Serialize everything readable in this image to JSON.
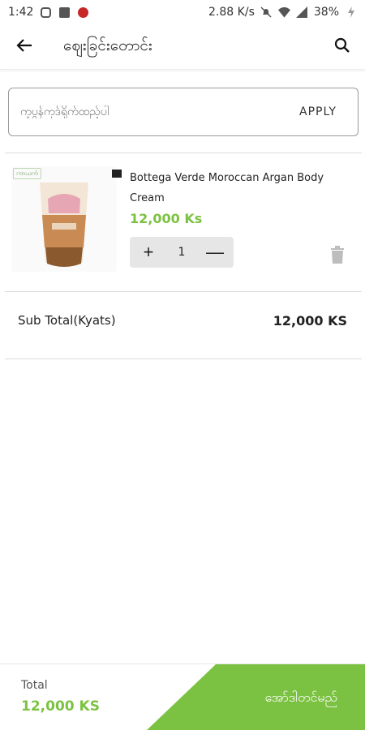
{
  "status_bar": {
    "time": "1:42",
    "net_speed": "2.88 K/s",
    "battery": "38%"
  },
  "header": {
    "title": "ဈေးခြင်းတောင်း",
    "back_icon": "arrow-left-icon",
    "search_icon": "search-icon"
  },
  "coupon": {
    "placeholder": "ကူပွန်ကုဒ်ရိုက်ထည့်ပါ",
    "apply_label": "APPLY"
  },
  "cart_items": [
    {
      "name": "Bottega Verde Moroccan Argan Body Cream",
      "price": "12,000 Ks",
      "quantity": "1",
      "increase_symbol": "+",
      "decrease_symbol": "—",
      "image_badge": "ကာယကံ"
    }
  ],
  "subtotal": {
    "label": "Sub Total(Kyats)",
    "value": "12,000 KS"
  },
  "footer": {
    "total_label": "Total",
    "total_value": "12,000 KS",
    "order_button_label": "အော်ဒါတင်မည်"
  },
  "colors": {
    "accent": "#7cc242",
    "stepper_bg": "#e6e6e6"
  }
}
